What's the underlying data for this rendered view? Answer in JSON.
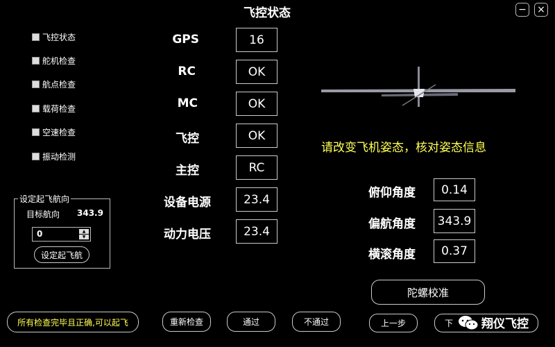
{
  "window": {
    "title": "飞控状态",
    "minimize_glyph": "−",
    "close_glyph": "×"
  },
  "checklist": [
    {
      "label": "飞控状态",
      "checked": false
    },
    {
      "label": "舵机检查",
      "checked": false
    },
    {
      "label": "航点检查",
      "checked": false
    },
    {
      "label": "载荷检查",
      "checked": false
    },
    {
      "label": "空速检查",
      "checked": false
    },
    {
      "label": "振动检测",
      "checked": false
    }
  ],
  "takeoff_heading": {
    "group_title": "设定起飞航向",
    "target_label": "目标航向",
    "target_value": "343.9",
    "input_value": "0",
    "set_button": "设定起飞航"
  },
  "status": [
    {
      "label": "GPS",
      "value": "16"
    },
    {
      "label": "RC",
      "value": "OK"
    },
    {
      "label": "MC",
      "value": "OK"
    },
    {
      "label": "飞控",
      "value": "OK"
    },
    {
      "label": "主控",
      "value": "RC"
    },
    {
      "label": "设备电源",
      "value": "23.4"
    },
    {
      "label": "动力电压",
      "value": "23.4"
    }
  ],
  "attitude": {
    "hint": "请改变飞机姿态，核对姿态信息",
    "pitch_label": "俯仰角度",
    "pitch_value": "0.14",
    "yaw_label": "偏航角度",
    "yaw_value": "343.9",
    "roll_label": "横滚角度",
    "roll_value": "0.37",
    "gyro_button": "陀螺校准"
  },
  "footer": {
    "notice": "所有检查完毕且正确,可以起飞",
    "recheck": "重新检查",
    "pass": "通过",
    "fail": "不通过",
    "prev": "上一步",
    "next": "下"
  },
  "watermark": "翔仪飞控",
  "colors": {
    "hint": "#ffff55",
    "notice": "#ffff55",
    "background": "#000000"
  }
}
